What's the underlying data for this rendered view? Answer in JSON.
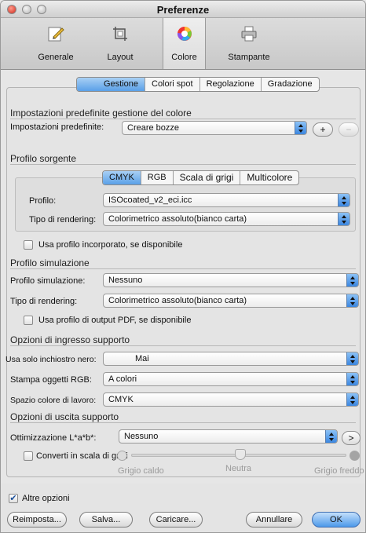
{
  "window": {
    "title": "Preferenze"
  },
  "toolbar": {
    "items": [
      {
        "label": "Generale",
        "icon": "pencil-doc-icon"
      },
      {
        "label": "Layout",
        "icon": "crop-icon"
      },
      {
        "label": "Colore",
        "icon": "color-wheel-icon"
      },
      {
        "label": "Stampante",
        "icon": "printer-icon"
      }
    ]
  },
  "tabs": [
    "Gestione",
    "Colori spot",
    "Regolazione",
    "Gradazione"
  ],
  "presets": {
    "heading": "Impostazioni predefinite gestione del colore",
    "label": "Impostazioni predefinite:",
    "value": "Creare bozze",
    "add": "+",
    "remove": "−"
  },
  "source": {
    "heading": "Profilo sorgente",
    "tabs": [
      "CMYK",
      "RGB",
      "Scala di grigi",
      "Multicolore"
    ],
    "profile_label": "Profilo:",
    "profile_value": "ISOcoated_v2_eci.icc",
    "rendering_label": "Tipo di rendering:",
    "rendering_value": "Colorimetrico assoluto(bianco carta)",
    "embedded_label": "Usa profilo incorporato, se disponibile"
  },
  "simulation": {
    "heading": "Profilo simulazione",
    "profile_label": "Profilo simulazione:",
    "profile_value": "Nessuno",
    "rendering_label": "Tipo di rendering:",
    "rendering_value": "Colorimetrico assoluto(bianco carta)",
    "pdf_label": "Usa profilo di output PDF, se disponibile"
  },
  "input": {
    "heading": "Opzioni di ingresso supporto",
    "black_label": "Usa solo inchiostro nero:",
    "black_value": "Mai",
    "rgb_label": "Stampa oggetti RGB:",
    "rgb_value": "A colori",
    "space_label": "Spazio colore di lavoro:",
    "space_value": "CMYK"
  },
  "output": {
    "heading": "Opzioni di uscita supporto",
    "lab_label": "Ottimizzazione L*a*b*:",
    "lab_value": "Nessuno",
    "gray_label": "Converti in scala di grigi",
    "warm": "Grigio caldo",
    "neutral": "Neutra",
    "cold": "Grigio freddo"
  },
  "footer": {
    "more_label": "Altre opzioni",
    "reset": "Reimposta...",
    "save": "Salva...",
    "load": "Caricare...",
    "cancel": "Annullare",
    "ok": "OK"
  },
  "colors": {
    "accent": "#4c99ea"
  }
}
